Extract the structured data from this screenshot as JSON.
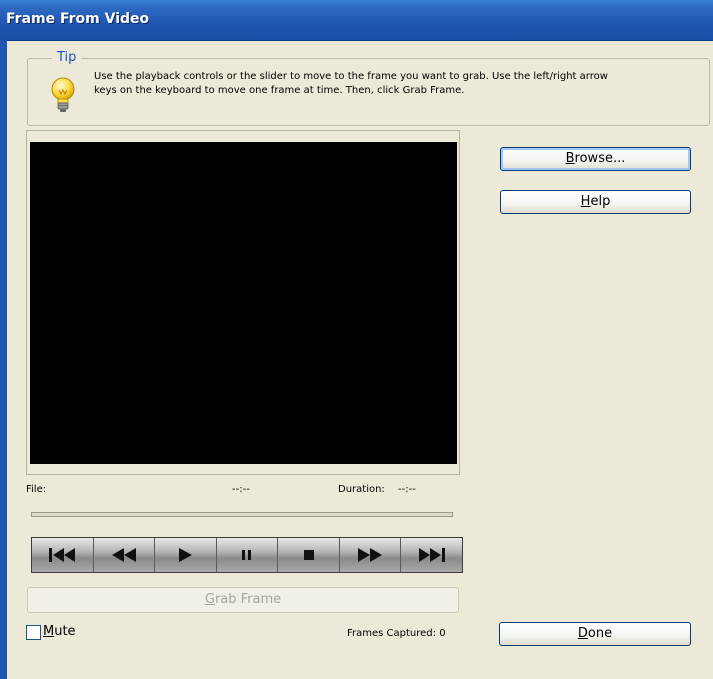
{
  "window": {
    "title": "Frame From Video"
  },
  "tip": {
    "legend": "Tip",
    "line1": "Use the playback controls or the slider to move to the frame you want to grab. Use the left/right arrow",
    "line2": "keys on the keyboard to move one frame at time. Then, click Grab Frame.",
    "icon": "lightbulb-icon"
  },
  "info": {
    "file_label": "File:",
    "file_time": "--:--",
    "duration_label": "Duration:",
    "duration_value": "--:--"
  },
  "slider": {
    "position": 0
  },
  "transport": {
    "buttons": [
      "skip-to-start-icon",
      "rewind-icon",
      "play-icon",
      "pause-icon",
      "stop-icon",
      "fast-forward-icon",
      "skip-to-end-icon"
    ]
  },
  "grab": {
    "pre": "",
    "accel": "G",
    "post": "rab Frame",
    "enabled": false
  },
  "browse": {
    "accel": "B",
    "post": "rowse..."
  },
  "help": {
    "accel": "H",
    "post": "elp"
  },
  "mute": {
    "accel": "M",
    "post": "ute",
    "checked": false
  },
  "frames_captured": "Frames Captured: 0",
  "done": {
    "accel": "D",
    "post": "one"
  },
  "colors": {
    "title_blue": "#1f55b0",
    "tip_legend": "#1f52c3",
    "face": "#ece9d8"
  }
}
